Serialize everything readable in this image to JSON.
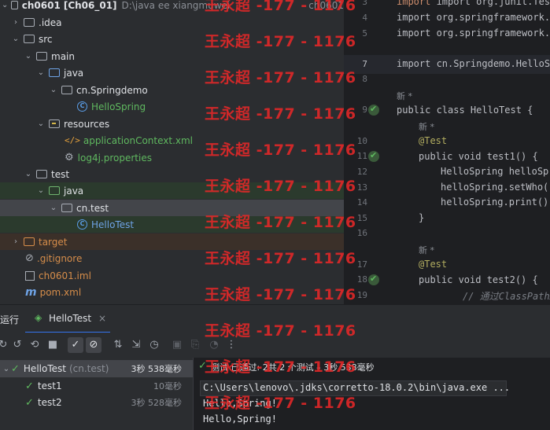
{
  "project": {
    "root_name": "ch0601",
    "root_module": "[Ch06_01]",
    "root_path": "D:\\java ee xiangmuwei",
    "root_path_end": "ch0601",
    "idea": ".idea",
    "src": "src",
    "main": "main",
    "java_main": "java",
    "pkg_main": "cn.Springdemo",
    "hello_spring": "HelloSpring",
    "resources": "resources",
    "app_ctx": "applicationContext.xml",
    "log4j": "log4j.properties",
    "test": "test",
    "java_test": "java",
    "pkg_test": "cn.test",
    "hello_test": "HelloTest",
    "target": "target",
    "gitignore": ".gitignore",
    "iml": "ch0601.iml",
    "pom": "pom.xml"
  },
  "editor": {
    "lines": [
      {
        "num": "3",
        "code": "import org.junit.Test;"
      },
      {
        "num": "4",
        "code": "import org.springframework.c"
      },
      {
        "num": "5",
        "code": "import org.springframework.c"
      },
      {
        "num": "6",
        "code": ""
      },
      {
        "num": "7",
        "code": "import cn.Springdemo.HelloSpr"
      },
      {
        "num": "8",
        "code": ""
      },
      {
        "num": "9",
        "code": "public class HelloTest {"
      },
      {
        "num": "10",
        "code": "@Test"
      },
      {
        "num": "11",
        "code": "public void test1() {"
      },
      {
        "num": "12",
        "code": "HelloSpring helloSpr"
      },
      {
        "num": "13",
        "code": "helloSpring.setWho(\""
      },
      {
        "num": "14",
        "code": "helloSpring.print();"
      },
      {
        "num": "15",
        "code": "}"
      },
      {
        "num": "16",
        "code": ""
      },
      {
        "num": "17",
        "code": "@Test"
      },
      {
        "num": "18",
        "code": "public void test2() {"
      },
      {
        "num": "19",
        "code": "// 通过ClassPathXmlA"
      }
    ],
    "hint_new": "新 *"
  },
  "run": {
    "label": "运行",
    "tab": "HelloTest",
    "status": "测试 已通过: 2共 2 个测试 – 3秒 538毫秒"
  },
  "results": [
    {
      "name": "HelloTest",
      "extra": "(cn.test)",
      "time": "3秒 538毫秒"
    },
    {
      "name": "test1",
      "extra": "",
      "time": "10毫秒"
    },
    {
      "name": "test2",
      "extra": "",
      "time": "3秒 528毫秒"
    }
  ],
  "console": {
    "cmd": "C:\\Users\\lenovo\\.jdks\\corretto-18.0.2\\bin\\java.exe ...",
    "out1": "Hello,Spring!",
    "out2": "Hello,Spring!"
  },
  "watermark": "王永超 -177 - 1176",
  "colors": {
    "accent_green": "#5fb85f",
    "folder_blue": "#6ea3e6",
    "watermark_red": "#e62828"
  }
}
